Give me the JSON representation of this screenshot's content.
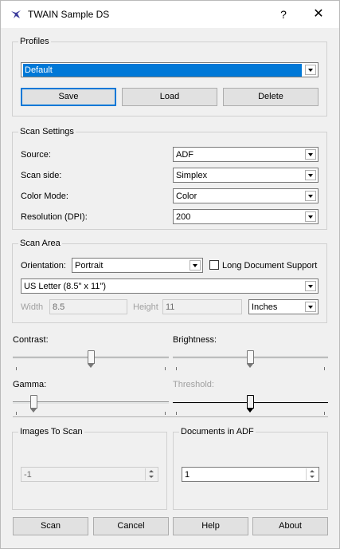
{
  "window": {
    "title": "TWAIN Sample DS",
    "help_glyph": "?",
    "close_glyph": "✕"
  },
  "profiles": {
    "group_label": "Profiles",
    "selected": "Default",
    "save_label": "Save",
    "load_label": "Load",
    "delete_label": "Delete"
  },
  "scan_settings": {
    "group_label": "Scan Settings",
    "source_label": "Source:",
    "source_value": "ADF",
    "scan_side_label": "Scan side:",
    "scan_side_value": "Simplex",
    "color_mode_label": "Color Mode:",
    "color_mode_value": "Color",
    "resolution_label": "Resolution (DPI):",
    "resolution_value": "200"
  },
  "scan_area": {
    "group_label": "Scan Area",
    "orientation_label": "Orientation:",
    "orientation_value": "Portrait",
    "long_doc_label": "Long Document Support",
    "paper_size_value": "US Letter (8.5\" x 11\")",
    "width_label": "Width",
    "width_value": "8.5",
    "height_label": "Height",
    "height_value": "11",
    "units_value": "Inches"
  },
  "adjustments": {
    "contrast_label": "Contrast:",
    "contrast_level": 0.5,
    "brightness_label": "Brightness:",
    "brightness_level": 0.5,
    "gamma_label": "Gamma:",
    "gamma_level": 0.12,
    "threshold_label": "Threshold:",
    "threshold_level": 0.5
  },
  "images_to_scan": {
    "group_label": "Images To Scan",
    "value": "-1"
  },
  "documents_in_adf": {
    "group_label": "Documents in ADF",
    "value": "1"
  },
  "footer": {
    "scan_label": "Scan",
    "cancel_label": "Cancel",
    "help_label": "Help",
    "about_label": "About"
  }
}
